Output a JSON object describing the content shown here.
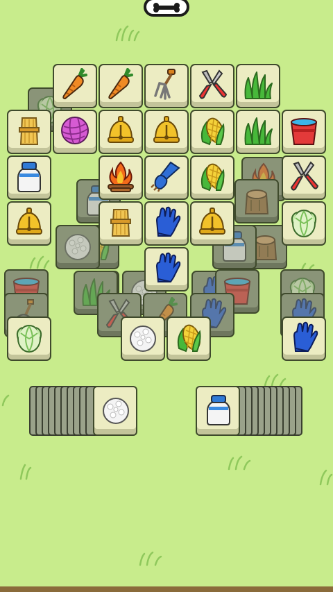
{
  "board": {
    "colors": {
      "background": "#c8ec8c",
      "tile_face": "#ececc2",
      "tile_shade": "#8a9478"
    },
    "tiles": [
      {
        "icon": "cabbage",
        "layer": "under"
      },
      {
        "icon": "corn",
        "layer": "under"
      },
      {
        "icon": "corn",
        "layer": "under"
      },
      {
        "icon": "blue-glove",
        "layer": "under"
      },
      {
        "icon": "tree-stump",
        "layer": "under"
      },
      {
        "icon": "campfire",
        "layer": "under"
      },
      {
        "icon": "milk-bottle",
        "layer": "under"
      },
      {
        "icon": "rice-ball",
        "layer": "under"
      },
      {
        "icon": "rice-ball",
        "layer": "under"
      },
      {
        "icon": "tree-stump",
        "layer": "under"
      },
      {
        "icon": "milk-bottle",
        "layer": "under"
      },
      {
        "icon": "water-bucket",
        "layer": "under"
      },
      {
        "icon": "shovel",
        "layer": "under"
      },
      {
        "icon": "grass-tuft",
        "layer": "under"
      },
      {
        "icon": "carrot",
        "layer": "under"
      },
      {
        "icon": "blue-glove",
        "layer": "under"
      },
      {
        "icon": "water-bucket",
        "layer": "under"
      },
      {
        "icon": "cabbage",
        "layer": "under"
      },
      {
        "icon": "blue-glove",
        "layer": "under"
      },
      {
        "icon": "shears",
        "layer": "under"
      },
      {
        "icon": "carrot",
        "layer": "top"
      },
      {
        "icon": "carrot",
        "layer": "top"
      },
      {
        "icon": "garden-fork",
        "layer": "top"
      },
      {
        "icon": "shears",
        "layer": "top"
      },
      {
        "icon": "grass-tuft",
        "layer": "top"
      },
      {
        "icon": "hay-bundle",
        "layer": "top"
      },
      {
        "icon": "yarn-ball",
        "layer": "top"
      },
      {
        "icon": "bell",
        "layer": "top"
      },
      {
        "icon": "bell",
        "layer": "top"
      },
      {
        "icon": "corn",
        "layer": "top"
      },
      {
        "icon": "grass-tuft",
        "layer": "top"
      },
      {
        "icon": "water-bucket",
        "layer": "top"
      },
      {
        "icon": "milk-bottle",
        "layer": "top"
      },
      {
        "icon": "campfire",
        "layer": "top"
      },
      {
        "icon": "grooming-brush",
        "layer": "top"
      },
      {
        "icon": "corn",
        "layer": "top"
      },
      {
        "icon": "shears",
        "layer": "top"
      },
      {
        "icon": "bell",
        "layer": "top"
      },
      {
        "icon": "hay-bundle",
        "layer": "top"
      },
      {
        "icon": "blue-glove",
        "layer": "top"
      },
      {
        "icon": "bell",
        "layer": "top"
      },
      {
        "icon": "cabbage",
        "layer": "top"
      },
      {
        "icon": "blue-glove",
        "layer": "top"
      },
      {
        "icon": "cabbage",
        "layer": "top"
      },
      {
        "icon": "rice-ball",
        "layer": "top"
      },
      {
        "icon": "corn",
        "layer": "top"
      },
      {
        "icon": "blue-glove",
        "layer": "top"
      }
    ]
  },
  "stacks": [
    {
      "name": "left-stack",
      "top_icon": "rice-ball",
      "cards_below": 10
    },
    {
      "name": "right-stack",
      "top_icon": "milk-bottle",
      "cards_below": 10
    }
  ]
}
